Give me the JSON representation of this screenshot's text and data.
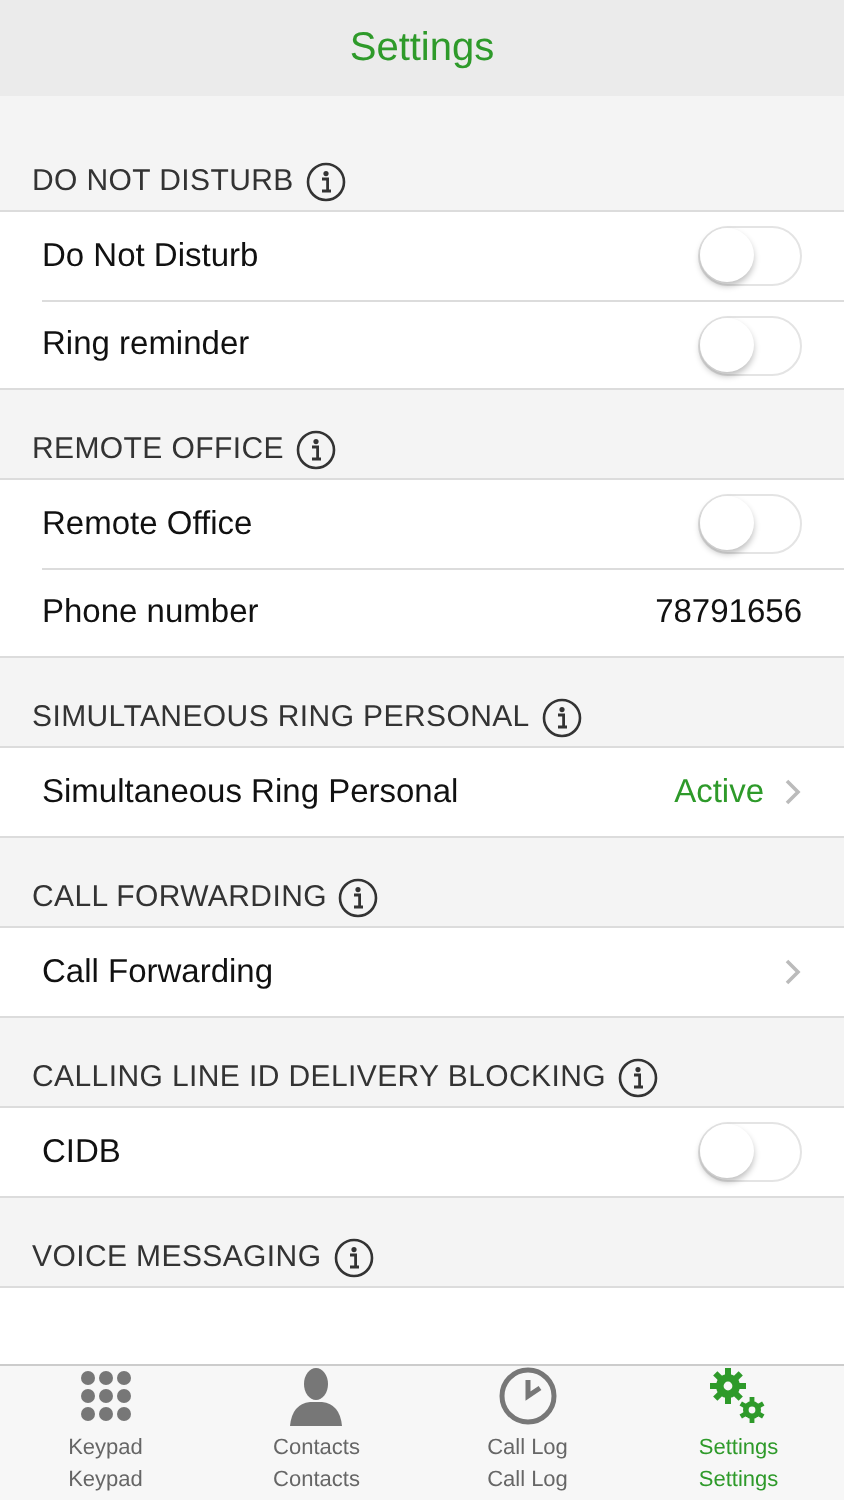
{
  "header": {
    "title": "Settings"
  },
  "sections": [
    {
      "title": "DO NOT DISTURB",
      "rows": [
        {
          "kind": "toggle",
          "label": "Do Not Disturb",
          "on": false
        },
        {
          "kind": "toggle",
          "label": "Ring reminder",
          "on": false
        }
      ]
    },
    {
      "title": "REMOTE OFFICE",
      "rows": [
        {
          "kind": "toggle",
          "label": "Remote Office",
          "on": false
        },
        {
          "kind": "value",
          "label": "Phone number",
          "value": "78791656"
        }
      ]
    },
    {
      "title": "SIMULTANEOUS RING PERSONAL",
      "rows": [
        {
          "kind": "link",
          "label": "Simultaneous Ring Personal",
          "value": "Active"
        }
      ]
    },
    {
      "title": "CALL FORWARDING",
      "rows": [
        {
          "kind": "link",
          "label": "Call Forwarding"
        }
      ]
    },
    {
      "title": "CALLING LINE ID DELIVERY BLOCKING",
      "rows": [
        {
          "kind": "toggle",
          "label": "CIDB",
          "on": false
        }
      ]
    },
    {
      "title": "VOICE MESSAGING"
    }
  ],
  "tabs": [
    {
      "kind": "keypad",
      "label": "Keypad",
      "sublabel": "Keypad",
      "selected": false
    },
    {
      "kind": "contacts",
      "label": "Contacts",
      "sublabel": "Contacts",
      "selected": false
    },
    {
      "kind": "calllog",
      "label": "Call Log",
      "sublabel": "Call Log",
      "selected": false
    },
    {
      "kind": "settings",
      "label": "Settings",
      "sublabel": "Settings",
      "selected": true
    }
  ]
}
